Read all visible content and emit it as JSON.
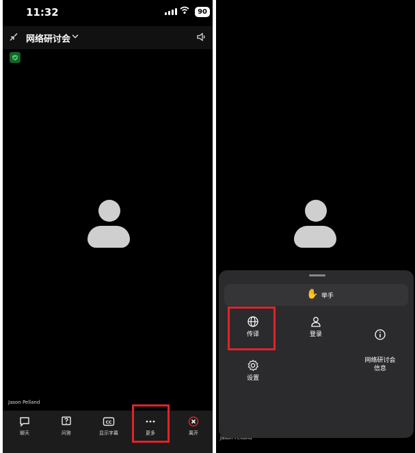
{
  "left": {
    "status": {
      "time": "11:32",
      "battery": "90"
    },
    "header": {
      "title": "网络研讨会"
    },
    "participant_name": "Jason Pelland",
    "bottom_bar": [
      {
        "label": "聊天",
        "icon": "chat-icon"
      },
      {
        "label": "问答",
        "icon": "qa-icon"
      },
      {
        "label": "显示字幕",
        "icon": "captions-icon"
      },
      {
        "label": "更多",
        "icon": "more-icon"
      },
      {
        "label": "离开",
        "icon": "leave-icon"
      }
    ]
  },
  "right": {
    "participant_name": "Jason Pelland",
    "sheet": {
      "raise_hand": {
        "label": "举手",
        "icon": "raised-hand-icon"
      },
      "options": [
        {
          "label": "传译",
          "icon": "globe-icon"
        },
        {
          "label": "登录",
          "icon": "person-icon"
        },
        {
          "label": "网络研讨会\n信息",
          "icon": "info-icon"
        },
        {
          "label": "设置",
          "icon": "gear-icon"
        }
      ]
    }
  },
  "colors": {
    "highlight": "#e1232a",
    "background": "#000000",
    "bar": "#1c1c1c",
    "sheet": "#2b2b2d"
  }
}
